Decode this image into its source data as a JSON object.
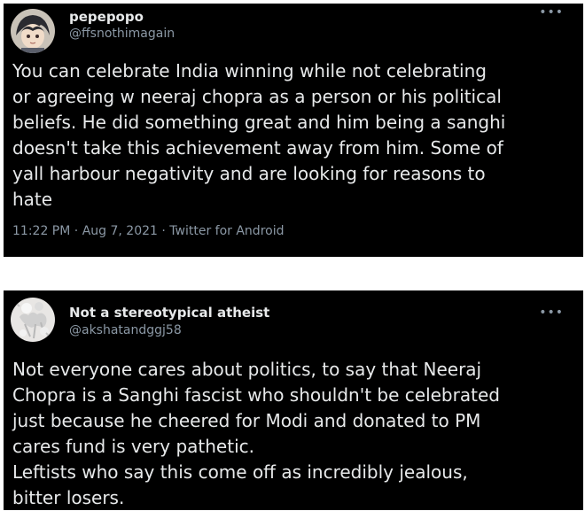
{
  "tweets": [
    {
      "name": "pepepopo",
      "handle": "@ffsnothimagain",
      "more_icon": "more-options-icon",
      "lines": [
        "You can celebrate India winning while not celebrating",
        "or agreeing w neeraj chopra as a person or his political",
        "beliefs. He did something great and him being a sanghi",
        "doesn't take this achievement away from him. Some of",
        "yall harbour negativity and are looking for reasons to",
        "hate"
      ],
      "time": "11:22 PM",
      "date": "Aug 7, 2021",
      "source": "Twitter for Android"
    },
    {
      "name": "Not a stereotypical atheist",
      "handle": "@akshatandggj58",
      "more_icon": "more-options-icon",
      "lines": [
        "Not everyone cares about politics, to say that Neeraj",
        "Chopra is a Sanghi fascist who shouldn't be celebrated",
        "just because he cheered for Modi and donated to PM",
        "cares fund is very pathetic.",
        "Leftists who say this come off as incredibly jealous,",
        "bitter losers."
      ]
    }
  ],
  "colors": {
    "background": "#000000",
    "text": "#e7e9ea",
    "secondary": "#8b98a5",
    "page": "#ffffff"
  }
}
